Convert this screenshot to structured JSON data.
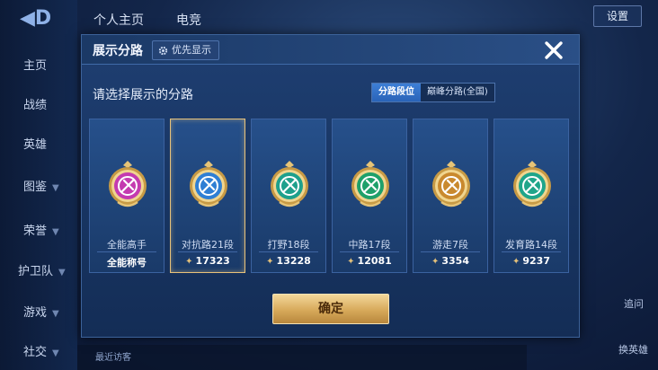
{
  "background": {
    "tabs": [
      "个人主页",
      "电竞"
    ],
    "nav": [
      "主页",
      "战绩",
      "英雄",
      "图鉴",
      "荣誉",
      "护卫队",
      "游戏",
      "社交"
    ],
    "settings_label": "设置",
    "right_labels": [
      "追问",
      "换英雄"
    ],
    "bottom_text": "最近访客"
  },
  "dialog": {
    "title": "展示分路",
    "priority_label": "优先显示",
    "subtitle": "请选择展示的分路",
    "segments": [
      "分路段位",
      "巅峰分路(全国)"
    ],
    "active_segment": 0,
    "confirm_label": "确定"
  },
  "cards": [
    {
      "role": "全能高手",
      "score": "全能称号",
      "emblem_color": "#c43bb0",
      "icon": "all-round-emblem-icon"
    },
    {
      "role": "对抗路21段",
      "score": "17323",
      "emblem_color": "#2f7fd4",
      "icon": "clash-lane-emblem-icon",
      "selected": true
    },
    {
      "role": "打野18段",
      "score": "13228",
      "emblem_color": "#1ea08c",
      "icon": "jungle-emblem-icon"
    },
    {
      "role": "中路17段",
      "score": "12081",
      "emblem_color": "#1ea06a",
      "icon": "mid-lane-emblem-icon"
    },
    {
      "role": "游走7段",
      "score": "3354",
      "emblem_color": "#c9892e",
      "icon": "roam-emblem-icon"
    },
    {
      "role": "发育路14段",
      "score": "9237",
      "emblem_color": "#1fa58a",
      "icon": "farm-lane-emblem-icon"
    }
  ]
}
